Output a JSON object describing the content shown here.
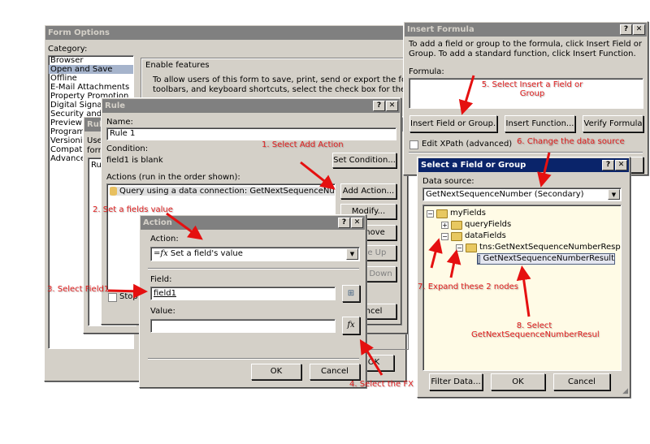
{
  "form_options": {
    "title": "Form Options",
    "category_label": "Category:",
    "categories": [
      "Browser",
      "Open and Save",
      "Offline",
      "E-Mail Attachments",
      "Property Promotion",
      "Digital Signatures",
      "Security and Trust",
      "Preview",
      "Programming",
      "Versioning",
      "Compatibility",
      "Advanced"
    ],
    "selected_category": "Open and Save",
    "group_label": "Enable features",
    "group_text_1": "To allow users of this form to save, print, send or export the form using menus,",
    "group_text_2": "toolbars, and keyboard shortcuts, select the check box for the command below.",
    "ok_label": "OK"
  },
  "rules_dialog": {
    "title": "Rules",
    "text_1": "Use",
    "text_2": "form",
    "list_header": "Rule"
  },
  "rule_dialog": {
    "title": "Rule",
    "name_label": "Name:",
    "name_value": "Rule 1",
    "condition_label": "Condition:",
    "condition_value": "field1 is blank",
    "set_condition": "Set Condition...",
    "actions_label": "Actions (run in the order shown):",
    "actions": [
      "Query using a data connection: GetNextSequenceNumber"
    ],
    "add_action": "Add Action...",
    "modify": "Modify...",
    "remove": "Remove",
    "move_up": "Move Up",
    "move_down": "Move Down",
    "cancel": "Cancel",
    "stop_label": "Stop"
  },
  "action_dialog": {
    "title": "Action",
    "action_label": "Action:",
    "action_value": "Set a field's value",
    "field_label": "Field:",
    "field_value": "field1",
    "value_label": "Value:",
    "value_value": "",
    "fx_label": "fx",
    "ok": "OK",
    "cancel": "Cancel"
  },
  "insert_formula": {
    "title": "Insert Formula",
    "instructions": "To add a field or group to the formula, click Insert Field or Group. To add a standard function, click Insert Function.",
    "formula_label": "Formula:",
    "formula_value": "",
    "insert_field": "Insert Field or Group...",
    "insert_function": "Insert Function...",
    "verify": "Verify Formula",
    "edit_xpath": "Edit XPath (advanced)"
  },
  "select_field": {
    "title": "Select a Field or Group",
    "data_source_label": "Data source:",
    "data_source_value": "GetNextSequenceNumber (Secondary)",
    "tree": [
      {
        "label": "myFields",
        "expander": "−",
        "type": "folder"
      },
      {
        "label": "queryFields",
        "expander": "+",
        "type": "folder"
      },
      {
        "label": "dataFields",
        "expander": "−",
        "type": "folder"
      },
      {
        "label": "tns:GetNextSequenceNumberResponse",
        "expander": "−",
        "type": "folder"
      },
      {
        "label": "GetNextSequenceNumberResult",
        "expander": "",
        "type": "field",
        "selected": true
      }
    ],
    "filter_data": "Filter Data...",
    "ok": "OK",
    "cancel": "Cancel"
  },
  "annotations": {
    "a1": "1. Select Add Action",
    "a2": "2. Set a fields value",
    "a3": "3. Select Field1",
    "a4": "4. Select the FX button",
    "a5_line1": "5. Select Insert a Field or",
    "a5_line2": "Group",
    "a6": "6. Change the data source",
    "a7": "7. Expand these 2 nodes",
    "a8_line1": "8. Select",
    "a8_line2": "GetNextSequenceNumberResul"
  },
  "colors": {
    "annotation": "#e02020",
    "active_title": "#0a246a",
    "inactive_title": "#808080",
    "dialog_bg": "#d4d0c8",
    "tree_bg": "#fffbe6"
  }
}
